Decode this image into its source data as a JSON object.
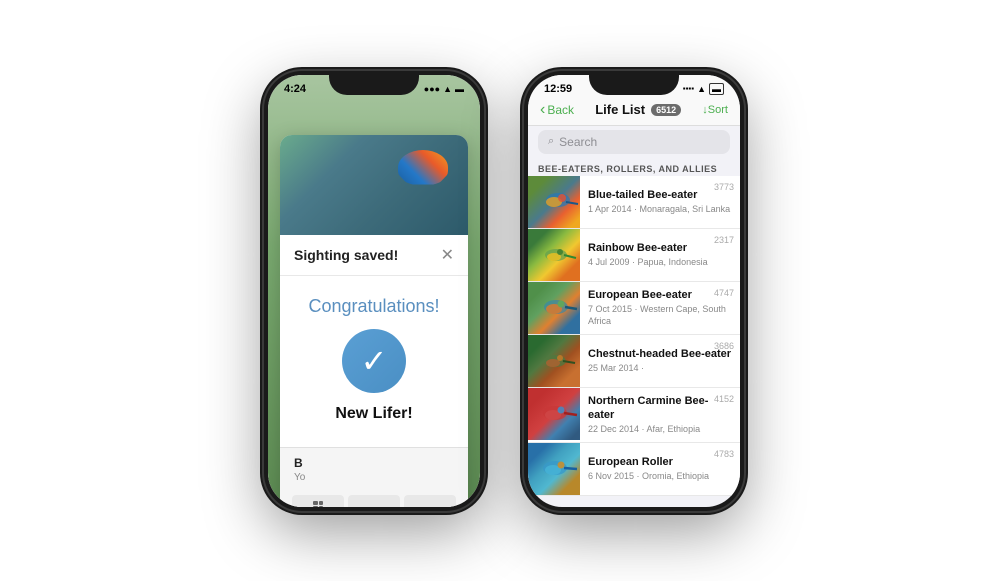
{
  "phone1": {
    "status_time": "4:24",
    "status_arrow": "↗",
    "notification_title": "Sighting saved!",
    "close_icon": "✕",
    "congrats_text": "Congratulations!",
    "checkmark": "✓",
    "new_lifer_label": "New Lifer!",
    "bottom_name": "B",
    "bottom_sub": "Yo",
    "action_grid": "⊞"
  },
  "phone2": {
    "status_time": "12:59",
    "nav_back": "Back",
    "nav_back_chevron": "‹",
    "nav_title": "Life List",
    "life_count": "6512",
    "sort_label": "↓Sort",
    "search_placeholder": "Search",
    "section_header": "BEE-EATERS, ROLLERS, AND ALLIES",
    "birds": [
      {
        "name": "Blue-tailed Bee-eater",
        "location": "1 Apr 2014 · Monaragala, Sri Lanka",
        "number": "3773",
        "color_class": "bird-blue-tailed"
      },
      {
        "name": "Rainbow Bee-eater",
        "location": "4 Jul 2009 · Papua, Indonesia",
        "number": "2317",
        "color_class": "bird-rainbow"
      },
      {
        "name": "European Bee-eater",
        "location": "7 Oct 2015 · Western Cape, South Africa",
        "number": "4747",
        "color_class": "bird-european"
      },
      {
        "name": "Chestnut-headed Bee-eater",
        "location": "25 Mar 2014 ·",
        "number": "3686",
        "color_class": "bird-chestnut"
      },
      {
        "name": "Northern Carmine Bee-eater",
        "location": "22 Dec 2014 · Afar, Ethiopia",
        "number": "4152",
        "color_class": "bird-carmine"
      },
      {
        "name": "European Roller",
        "location": "6 Nov 2015 · Oromia, Ethiopia",
        "number": "4783",
        "color_class": "bird-roller"
      }
    ]
  }
}
